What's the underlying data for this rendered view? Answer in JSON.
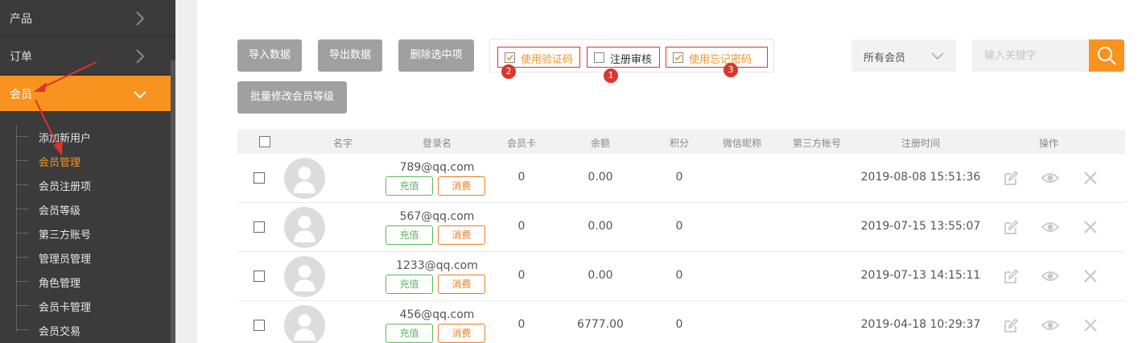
{
  "sidebar": {
    "menu": [
      {
        "label": "产品",
        "icon": "chevron-right-icon"
      },
      {
        "label": "订单",
        "icon": "chevron-right-icon"
      },
      {
        "label": "会员",
        "icon": "chevron-down-icon",
        "active": true
      }
    ],
    "submenu": [
      {
        "label": "添加新用户"
      },
      {
        "label": "会员管理",
        "active": true
      },
      {
        "label": "会员注册项"
      },
      {
        "label": "会员等级"
      },
      {
        "label": "第三方账号"
      },
      {
        "label": "管理员管理"
      },
      {
        "label": "角色管理"
      },
      {
        "label": "会员卡管理"
      },
      {
        "label": "会员交易"
      }
    ]
  },
  "toolbar": {
    "import_label": "导入数据",
    "export_label": "导出数据",
    "delete_label": "删除选中项",
    "batch_level_label": "批量修改会员等级",
    "options": [
      {
        "label": "使用验证码",
        "checked": true,
        "badge": "2"
      },
      {
        "label": "注册审核",
        "checked": false,
        "badge": "1"
      },
      {
        "label": "使用忘记密码",
        "checked": true,
        "badge": "3"
      }
    ],
    "member_filter": "所有会员",
    "search_placeholder": "输入关键字"
  },
  "table": {
    "columns": [
      "名字",
      "登录名",
      "会员卡",
      "余额",
      "积分",
      "微信昵称",
      "第三方帐号",
      "注册时间",
      "操作"
    ],
    "recharge_label": "充值",
    "spend_label": "消费",
    "rows": [
      {
        "login": "789@qq.com",
        "card": "0",
        "balance": "0.00",
        "points": "0",
        "registered": "2019-08-08 15:51:36"
      },
      {
        "login": "567@qq.com",
        "card": "0",
        "balance": "0.00",
        "points": "0",
        "registered": "2019-07-15 13:55:07"
      },
      {
        "login": "1233@qq.com",
        "card": "0",
        "balance": "0.00",
        "points": "0",
        "registered": "2019-07-13 14:15:11"
      },
      {
        "login": "456@qq.com",
        "card": "0",
        "balance": "6777.00",
        "points": "0",
        "registered": "2019-04-18 10:29:37"
      }
    ]
  },
  "colors": {
    "accent": "#f7931e",
    "sidebar_bg": "#3b3b3b",
    "annotation_red": "#d9372e",
    "recharge_green": "#5cb85c",
    "spend_orange": "#e67e22"
  }
}
